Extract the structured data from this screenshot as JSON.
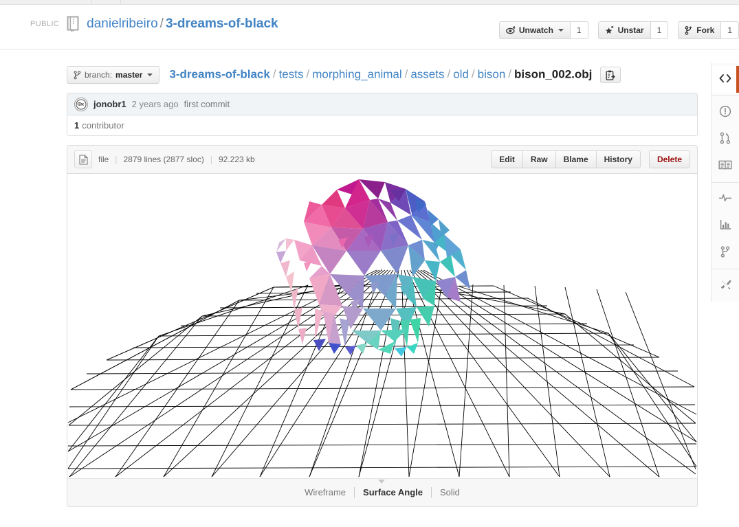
{
  "header": {
    "visibility_label": "PUBLIC",
    "owner": "danielribeiro",
    "separator": "/",
    "repo_name": "3-dreams-of-black",
    "actions": [
      {
        "label": "Unwatch",
        "count": "1",
        "icon": "eye-icon",
        "has_caret": true
      },
      {
        "label": "Unstar",
        "count": "1",
        "icon": "star-icon",
        "has_caret": false
      },
      {
        "label": "Fork",
        "count": "1",
        "icon": "fork-icon",
        "has_caret": false
      }
    ]
  },
  "breadcrumb": {
    "branch_prefix": "branch:",
    "branch_name": "master",
    "repo_root": "3-dreams-of-black",
    "segments": [
      "tests",
      "morphing_animal",
      "assets",
      "old",
      "bison"
    ],
    "file_name": "bison_002.obj",
    "copy_path_title": "copy-path"
  },
  "commit": {
    "author": "jonobr1",
    "time": "2 years ago",
    "message": "first commit",
    "contributor_count": "1",
    "contributor_label": "contributor"
  },
  "file": {
    "type_label": "file",
    "lines": "2879 lines (2877 sloc)",
    "size": "92.223 kb",
    "actions": [
      "Edit",
      "Raw",
      "Blame",
      "History"
    ],
    "delete_label": "Delete"
  },
  "viewer": {
    "modes": [
      "Wireframe",
      "Surface Angle",
      "Solid"
    ],
    "active_mode": "Surface Angle",
    "model_name": "bison",
    "ground_color": "#000000",
    "background_color": "#ffffff"
  },
  "sidebar": {
    "groups": [
      [
        {
          "name": "code",
          "icon": "code-icon",
          "active": true
        }
      ],
      [
        {
          "name": "issues",
          "icon": "issue-opened-icon",
          "active": false
        },
        {
          "name": "pull-requests",
          "icon": "git-pull-request-icon",
          "active": false
        },
        {
          "name": "wiki",
          "icon": "book-icon",
          "active": false
        }
      ],
      [
        {
          "name": "pulse",
          "icon": "pulse-icon",
          "active": false
        },
        {
          "name": "graphs",
          "icon": "graph-icon",
          "active": false
        },
        {
          "name": "network",
          "icon": "network-icon",
          "active": false
        }
      ],
      [
        {
          "name": "settings",
          "icon": "tools-icon",
          "active": false
        }
      ]
    ],
    "active_accent": "#c7511f"
  }
}
